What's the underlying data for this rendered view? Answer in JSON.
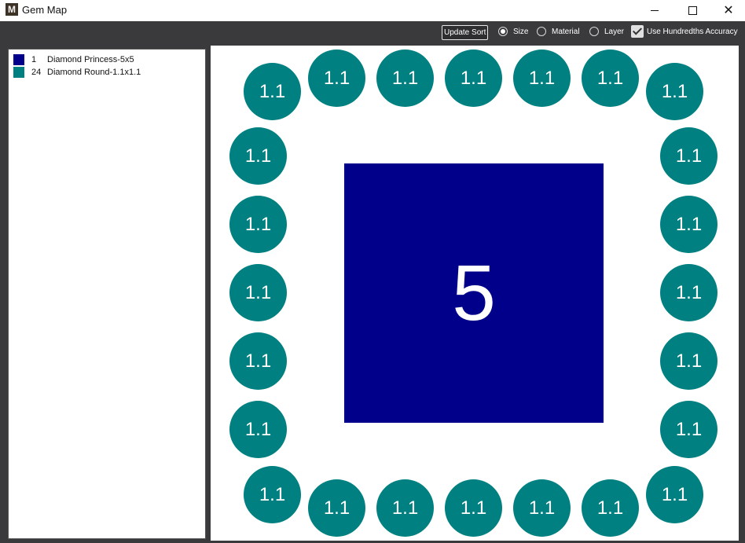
{
  "window": {
    "title": "Gem Map",
    "app_icon": "M"
  },
  "toolbar": {
    "update_sort_label": "Update Sort",
    "sort_options": [
      {
        "label": "Size",
        "selected": true
      },
      {
        "label": "Material",
        "selected": false
      },
      {
        "label": "Layer",
        "selected": false
      }
    ],
    "hundredths_label": "Use Hundredths Accuracy",
    "hundredths_checked": true
  },
  "legend": [
    {
      "count": "1",
      "name": "Diamond Princess-5x5",
      "color": "#00008b"
    },
    {
      "count": "24",
      "name": "Diamond Round-1.1x1.1",
      "color": "#008080"
    }
  ],
  "map": {
    "princess_label": "5",
    "princess_color": "#00008b",
    "round_color": "#008080",
    "round_labels": [
      "1.1",
      "1.1",
      "1.1",
      "1.1",
      "1.1",
      "1.1",
      "1.1",
      "1.1",
      "1.1",
      "1.1",
      "1.1",
      "1.1",
      "1.1",
      "1.1",
      "1.1",
      "1.1",
      "1.1",
      "1.1",
      "1.1",
      "1.1",
      "1.1",
      "1.1",
      "1.1",
      "1.1"
    ]
  }
}
